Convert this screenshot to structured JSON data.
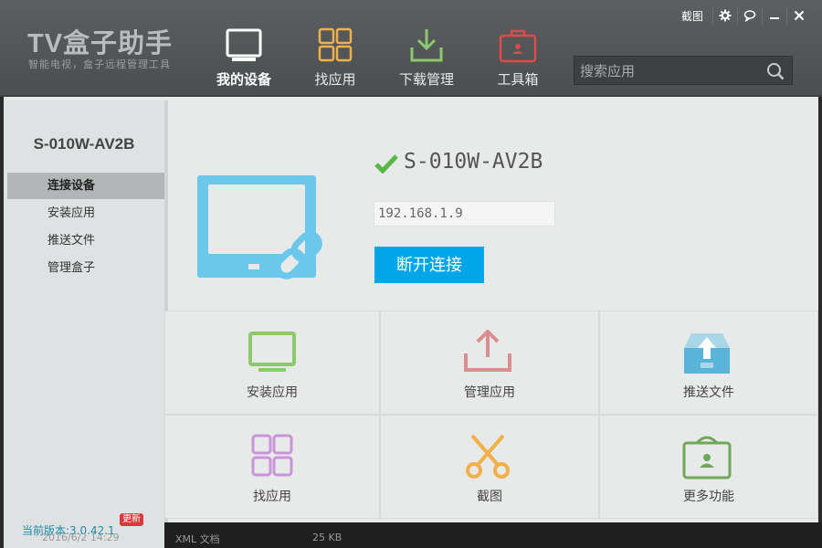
{
  "app": {
    "logo_title": "TV盒子助手",
    "logo_subtitle": "智能电视，盒子远程管理工具",
    "titlebar": {
      "screenshot_label": "截图",
      "icons": [
        "gear-icon",
        "chat-icon",
        "minimize-icon",
        "close-icon"
      ]
    },
    "nav": [
      {
        "label": "我的设备",
        "icon": "tv-icon",
        "active": true
      },
      {
        "label": "找应用",
        "icon": "apps-grid-icon",
        "active": false
      },
      {
        "label": "下载管理",
        "icon": "download-icon",
        "active": false
      },
      {
        "label": "工具箱",
        "icon": "toolbox-icon",
        "active": false
      }
    ],
    "search": {
      "placeholder": "搜索应用",
      "value": ""
    }
  },
  "sidebar": {
    "device_name": "S-010W-AV2B",
    "items": [
      {
        "label": "连接设备",
        "active": true
      },
      {
        "label": "安装应用",
        "active": false
      },
      {
        "label": "推送文件",
        "active": false
      },
      {
        "label": "管理盒子",
        "active": false
      }
    ],
    "version": "当前版本:3.0.42.1",
    "update_badge": "更新"
  },
  "device": {
    "name": "S-010W-AV2B",
    "ip": "192.168.1.9",
    "disconnect_label": "断开连接",
    "status_color": "#59b847"
  },
  "tiles": [
    {
      "label": "安装应用",
      "icon": "monitor-install-icon",
      "color": "#8dc86e"
    },
    {
      "label": "管理应用",
      "icon": "upload-tray-icon",
      "color": "#d98f8f"
    },
    {
      "label": "推送文件",
      "icon": "push-file-icon",
      "color": "#5ab3d9"
    },
    {
      "label": "找应用",
      "icon": "find-apps-grid-icon",
      "color": "#c893d8"
    },
    {
      "label": "截图",
      "icon": "scissors-icon",
      "color": "#f0b04a"
    },
    {
      "label": "更多功能",
      "icon": "more-box-icon",
      "color": "#6fa85a"
    }
  ],
  "background": {
    "row_date": "2016/6/2 14:29",
    "row_type": "XML 文档",
    "row_size": "25 KB"
  },
  "colors": {
    "accent": "#00a6e8",
    "topbar": "#4e5253",
    "content_bg": "#e8e9e9",
    "sidebar_bg": "#dfe2e2"
  }
}
